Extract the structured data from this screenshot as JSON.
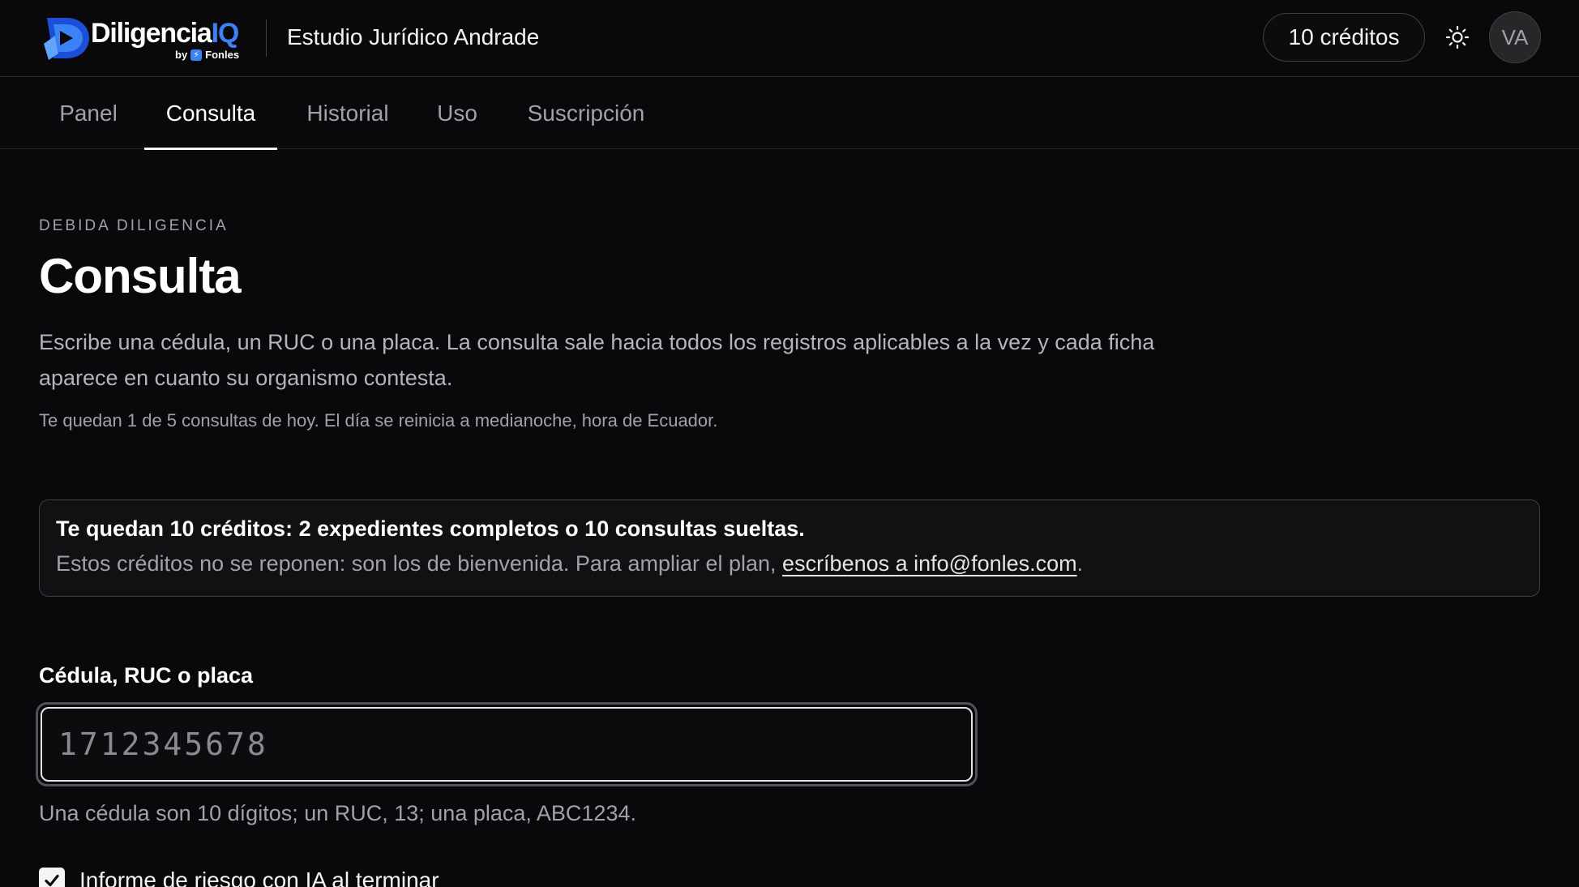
{
  "header": {
    "logo": {
      "word_main": "Diligencia",
      "word_accent": "IQ",
      "by": "by",
      "vendor": "Fonles"
    },
    "org_name": "Estudio Jurídico Andrade",
    "credits_label": "10 créditos",
    "theme_icon": "sun-icon",
    "avatar_initials": "VA"
  },
  "tabs": [
    {
      "label": "Panel",
      "active": false
    },
    {
      "label": "Consulta",
      "active": true
    },
    {
      "label": "Historial",
      "active": false
    },
    {
      "label": "Uso",
      "active": false
    },
    {
      "label": "Suscripción",
      "active": false
    }
  ],
  "main": {
    "eyebrow": "DEBIDA DILIGENCIA",
    "title": "Consulta",
    "lead": "Escribe una cédula, un RUC o una placa. La consulta sale hacia todos los registros aplicables a la vez y cada ficha aparece en cuanto su organismo contesta.",
    "quota": "Te quedan 1 de 5 consultas de hoy. El día se reinicia a medianoche, hora de Ecuador."
  },
  "notice": {
    "title": "Te quedan 10 créditos: 2 expedientes completos o 10 consultas sueltas.",
    "body": "Estos créditos no se reponen: son los de bienvenida. Para ampliar el plan, ",
    "link": "escríbenos a info@fonles.com",
    "suffix": "."
  },
  "form": {
    "label": "Cédula, RUC o placa",
    "value": "",
    "placeholder": "1712345678",
    "help": "Una cédula son 10 dígitos; un RUC, 13; una placa, ABC1234.",
    "ai_report_label": "Informe de riesgo con IA al terminar",
    "ai_report_checked": true
  },
  "colors": {
    "background": "#09090b",
    "accent": "#3b82f6",
    "text": "#f4f4f5",
    "muted": "#a1a1aa",
    "border": "#3f3f46"
  }
}
